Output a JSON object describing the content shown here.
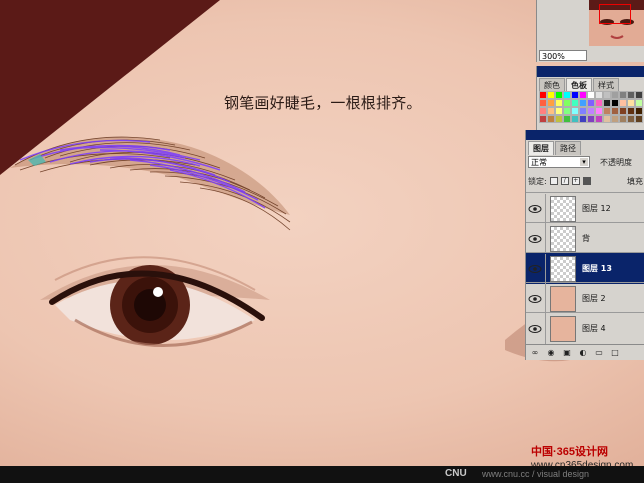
{
  "canvas": {
    "caption": "钢笔画好睫毛，一根根排齐。"
  },
  "navigator": {
    "zoom": "300%"
  },
  "swatches": {
    "tabs": [
      "颜色",
      "色板",
      "样式"
    ],
    "active_tab": "色板",
    "colors": [
      "#ff0000",
      "#ffff00",
      "#00ff00",
      "#00ffff",
      "#0000ff",
      "#ff00ff",
      "#ffffff",
      "#e0e0e0",
      "#c0c0c0",
      "#a0a0a0",
      "#808080",
      "#606060",
      "#404040",
      "#ff6040",
      "#ffa040",
      "#ffff60",
      "#80ff60",
      "#40ffc0",
      "#40a0ff",
      "#8060ff",
      "#ff60c0",
      "#202020",
      "#000000",
      "#ffc0a0",
      "#ffe0a0",
      "#c0ffa0",
      "#ff8080",
      "#ffc080",
      "#ffff80",
      "#80ff80",
      "#80ffff",
      "#8080ff",
      "#c080ff",
      "#ff80ff",
      "#c08060",
      "#a06040",
      "#804020",
      "#603010",
      "#402000",
      "#c04040",
      "#c08040",
      "#c0c040",
      "#40c040",
      "#40c0c0",
      "#4040c0",
      "#8040c0",
      "#c040c0",
      "#e0c0a0",
      "#c0a080",
      "#a08060",
      "#806040",
      "#604020"
    ]
  },
  "layers": {
    "tabs": [
      "图层",
      "路径"
    ],
    "active_tab": "图层",
    "blend_mode": "正常",
    "opacity_label": "不透明度",
    "lock_label": "锁定:",
    "fill_label": "填充",
    "items": [
      {
        "name": "图层 12",
        "thumb": "transparent",
        "selected": false
      },
      {
        "name": "背",
        "thumb": "transparent",
        "selected": false
      },
      {
        "name": "图层 13",
        "thumb": "transparent",
        "selected": true
      },
      {
        "name": "图层 2",
        "thumb": "face",
        "selected": false
      },
      {
        "name": "图层 4",
        "thumb": "face",
        "selected": false
      }
    ]
  },
  "watermark": {
    "cnu": "CNU",
    "url": "www.cnu.cc / visual design",
    "logo_top": "中国·365设计网",
    "logo_bottom": "www.cn365design.com"
  }
}
